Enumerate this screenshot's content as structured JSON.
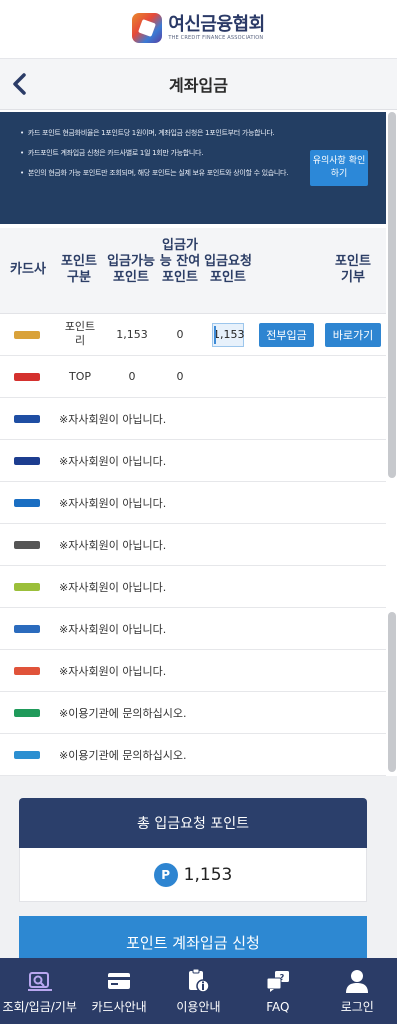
{
  "logo": {
    "name": "여신금융협회",
    "subtitle": "THE CREDIT FINANCE ASSOCIATION"
  },
  "header": {
    "title": "계좌입금"
  },
  "notice": {
    "items": [
      "카드 포인트 현금화비율은 1포인트당 1원이며, 계좌입금 신청은 1포인트부터 가능합니다.",
      "카드포인트 계좌입금 신청은 카드사별로 1일 1회만 가능합니다.",
      "본인의 현금화 가능 포인트만 조회되며, 해당 포인트는 실제 보유 포인트와 상이할 수 있습니다."
    ],
    "button_label": "유의사항 확인하기"
  },
  "table": {
    "headers": {
      "company": "카드사",
      "type": "포인트 구분",
      "available": "입금가능 포인트",
      "remaining": "입금가능 잔여포인트",
      "request": "입금요청 포인트",
      "donate": "포인트 기부"
    },
    "rows": [
      {
        "logo_color": "#d9a23a",
        "type": "포인트리",
        "available": "1,153",
        "remaining": "0",
        "request": "1,153",
        "btn_all": "전부입금",
        "btn_go": "바로가기"
      },
      {
        "logo_color": "#d4312e",
        "type": "TOP",
        "available": "0",
        "remaining": "0"
      },
      {
        "logo_color": "#1f4ea3",
        "message": "※자사회원이 아닙니다."
      },
      {
        "logo_color": "#1d3d8f",
        "message": "※자사회원이 아닙니다."
      },
      {
        "logo_color": "#1a6ec2",
        "message": "※자사회원이 아닙니다."
      },
      {
        "logo_color": "#555555",
        "message": "※자사회원이 아닙니다."
      },
      {
        "logo_color": "#9bbf3a",
        "message": "※자사회원이 아닙니다."
      },
      {
        "logo_color": "#2b6bbd",
        "message": "※자사회원이 아닙니다."
      },
      {
        "logo_color": "#e0533a",
        "message": "※자사회원이 아닙니다."
      },
      {
        "logo_color": "#1f9a5a",
        "message": "※이용기관에 문의하십시오."
      },
      {
        "logo_color": "#2b8fd1",
        "message": "※이용기관에 문의하십시오."
      }
    ]
  },
  "summary": {
    "title": "총 입금요청 포인트",
    "badge": "P",
    "value": "1,153"
  },
  "apply_button": "포인트 계좌입금 신청",
  "nav": {
    "items": [
      {
        "label": "조회/입금/기부"
      },
      {
        "label": "카드사안내"
      },
      {
        "label": "이용안내"
      },
      {
        "label": "FAQ"
      },
      {
        "label": "로그인"
      }
    ]
  },
  "colors": {
    "navy": "#2b3c67",
    "accent": "#2e85d1"
  }
}
